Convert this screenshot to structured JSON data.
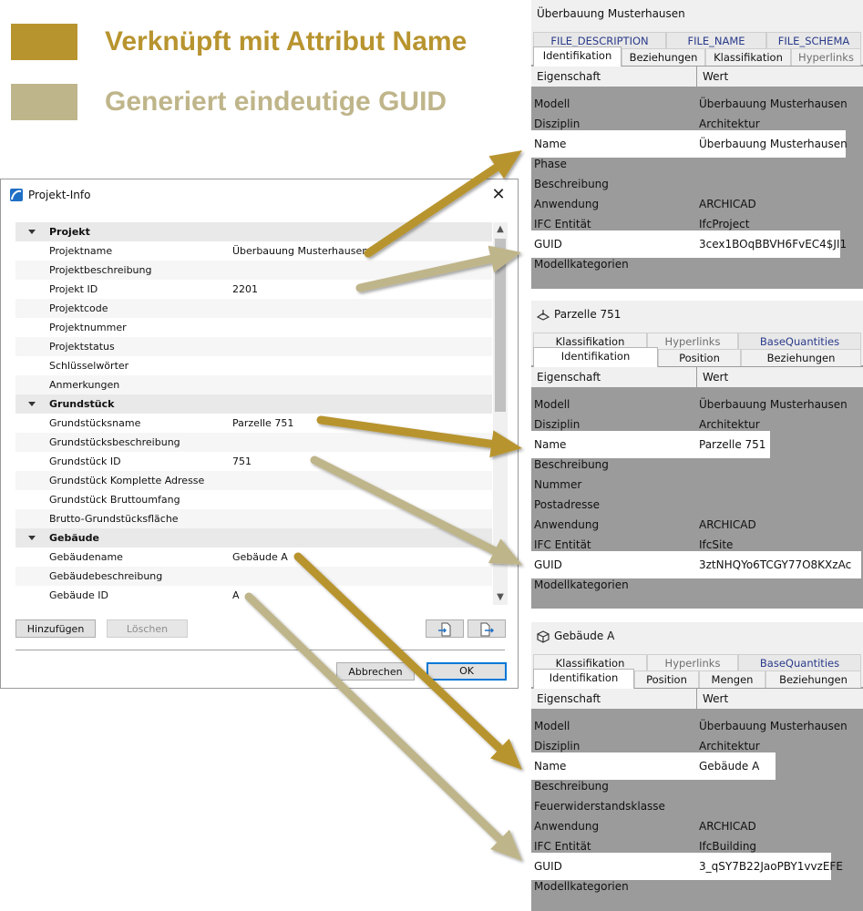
{
  "legend": {
    "linked": {
      "text": "Verknüpft mit Attribut Name",
      "color": "#b8942f"
    },
    "guid": {
      "text": "Generiert eindeutige GUID",
      "color": "#bfb58a"
    }
  },
  "dialog": {
    "title": "Projekt-Info",
    "close_glyph": "✕",
    "groups": [
      {
        "label": "Projekt",
        "rows": [
          {
            "label": "Projektname",
            "value": "Überbauung Musterhausen"
          },
          {
            "label": "Projektbeschreibung",
            "value": ""
          },
          {
            "label": "Projekt ID",
            "value": "2201"
          },
          {
            "label": "Projektcode",
            "value": ""
          },
          {
            "label": "Projektnummer",
            "value": ""
          },
          {
            "label": "Projektstatus",
            "value": ""
          },
          {
            "label": "Schlüsselwörter",
            "value": ""
          },
          {
            "label": "Anmerkungen",
            "value": ""
          }
        ]
      },
      {
        "label": "Grundstück",
        "rows": [
          {
            "label": "Grundstücksname",
            "value": "Parzelle 751"
          },
          {
            "label": "Grundstücksbeschreibung",
            "value": ""
          },
          {
            "label": "Grundstück ID",
            "value": "751"
          },
          {
            "label": "Grundstück Komplette Adresse",
            "value": ""
          },
          {
            "label": "Grundstück Bruttoumfang",
            "value": ""
          },
          {
            "label": "Brutto-Grundstücksfläche",
            "value": ""
          }
        ]
      },
      {
        "label": "Gebäude",
        "rows": [
          {
            "label": "Gebäudename",
            "value": "Gebäude A"
          },
          {
            "label": "Gebäudebeschreibung",
            "value": ""
          },
          {
            "label": "Gebäude ID",
            "value": "A"
          }
        ]
      }
    ],
    "buttons": {
      "add": "Hinzufügen",
      "delete": "Löschen",
      "cancel": "Abbrechen",
      "ok": "OK"
    }
  },
  "panels": [
    {
      "title": "Überbauung Musterhausen",
      "icon": "none",
      "back_tabs": [
        "FILE_DESCRIPTION",
        "FILE_NAME",
        "FILE_SCHEMA"
      ],
      "front_tabs": [
        "Identifikation",
        "Beziehungen",
        "Klassifikation",
        "Hyperlinks"
      ],
      "header": [
        "Eigenschaft",
        "Wert"
      ],
      "rows": [
        [
          "Modell",
          "Überbauung Musterhausen"
        ],
        [
          "Disziplin",
          "Architektur"
        ],
        [
          "Name",
          "Überbauung Musterhausen"
        ],
        [
          "Phase",
          ""
        ],
        [
          "Beschreibung",
          ""
        ],
        [
          "Anwendung",
          "ARCHICAD"
        ],
        [
          "IFC Entität",
          "IfcProject"
        ],
        [
          "GUID",
          "3cex1BOqBBVH6FvEC4$JI1"
        ],
        [
          "Modellkategorien",
          ""
        ]
      ]
    },
    {
      "title": "Parzelle 751",
      "icon": "site-icon",
      "back_tabs": [
        "Klassifikation",
        "Hyperlinks",
        "BaseQuantities"
      ],
      "front_tabs": [
        "Identifikation",
        "Position",
        "Beziehungen"
      ],
      "header": [
        "Eigenschaft",
        "Wert"
      ],
      "rows": [
        [
          "Modell",
          "Überbauung Musterhausen"
        ],
        [
          "Disziplin",
          "Architektur"
        ],
        [
          "Name",
          "Parzelle 751"
        ],
        [
          "Beschreibung",
          ""
        ],
        [
          "Nummer",
          ""
        ],
        [
          "Postadresse",
          ""
        ],
        [
          "Anwendung",
          "ARCHICAD"
        ],
        [
          "IFC Entität",
          "IfcSite"
        ],
        [
          "GUID",
          "3ztNHQYo6TCGY77O8KXzAc"
        ],
        [
          "Modellkategorien",
          ""
        ]
      ]
    },
    {
      "title": "Gebäude A",
      "icon": "building-icon",
      "back_tabs": [
        "Klassifikation",
        "Hyperlinks",
        "BaseQuantities"
      ],
      "front_tabs": [
        "Identifikation",
        "Position",
        "Mengen",
        "Beziehungen"
      ],
      "header": [
        "Eigenschaft",
        "Wert"
      ],
      "rows": [
        [
          "Modell",
          "Überbauung Musterhausen"
        ],
        [
          "Disziplin",
          "Architektur"
        ],
        [
          "Name",
          "Gebäude A"
        ],
        [
          "Beschreibung",
          ""
        ],
        [
          "Feuerwiderstandsklasse",
          ""
        ],
        [
          "Anwendung",
          "ARCHICAD"
        ],
        [
          "IFC Entität",
          "IfcBuilding"
        ],
        [
          "GUID",
          "3_qSY7B22JaoPBY1vvzEFE"
        ],
        [
          "Modellkategorien",
          ""
        ]
      ]
    }
  ]
}
